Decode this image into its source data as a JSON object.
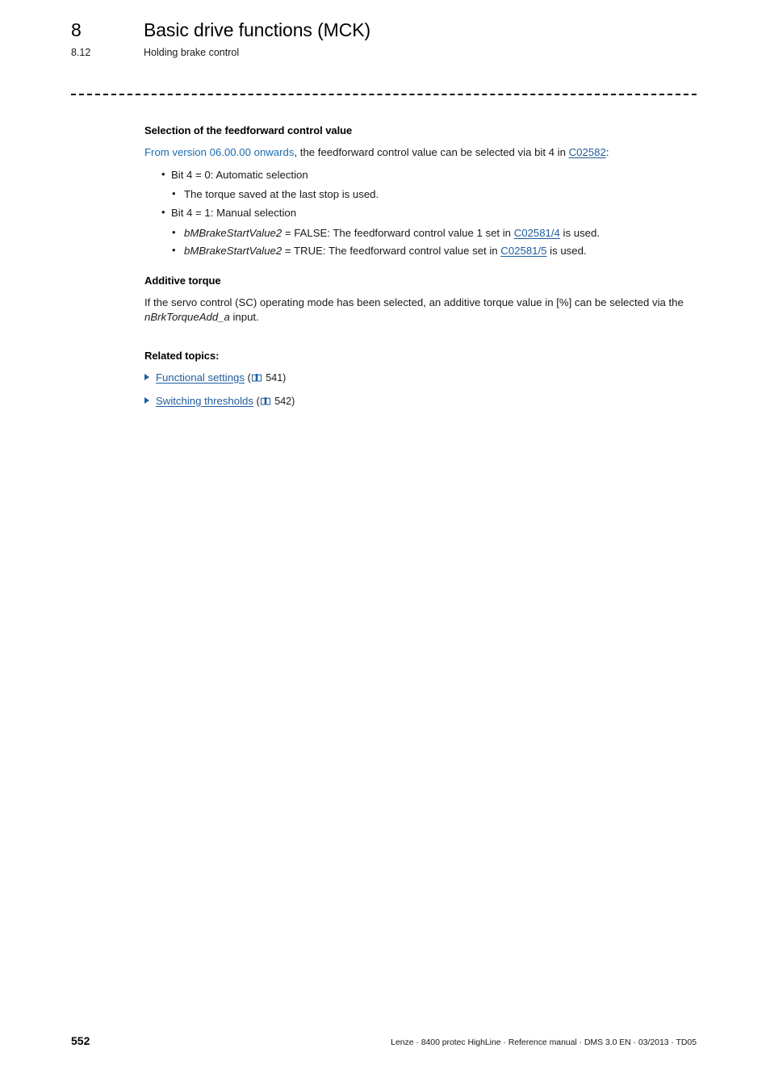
{
  "header": {
    "chapter_number": "8",
    "chapter_title": "Basic drive functions (MCK)",
    "section_number": "8.12",
    "section_title": "Holding brake control"
  },
  "content": {
    "feedforward": {
      "heading": "Selection of the feedforward control value",
      "intro_version": "From version 06.00.00 onwards",
      "intro_rest": ", the feedforward control value can be selected via bit 4 in ",
      "intro_link": "C02582",
      "intro_end": ":",
      "bullets": [
        {
          "text": "Bit 4 = 0: Automatic selection",
          "sub": [
            {
              "text": "The torque saved at the last stop is used."
            }
          ]
        },
        {
          "text": "Bit 4 = 1: Manual selection",
          "sub": [
            {
              "var": "bMBrakeStartValue2",
              "mid": " = FALSE: The feedforward control value 1 set in ",
              "link": "C02581/4",
              "end": " is used."
            },
            {
              "var": "bMBrakeStartValue2",
              "mid": " = TRUE: The feedforward control value set in ",
              "link": "C02581/5",
              "end": " is used."
            }
          ]
        }
      ]
    },
    "additive_torque": {
      "heading": "Additive torque",
      "body_start": "If the servo control (SC) operating mode has been selected, an additive torque value in [%] can be selected via the ",
      "body_var": "nBrkTorqueAdd_a",
      "body_end": " input."
    },
    "related_topics": {
      "heading": "Related topics:",
      "items": [
        {
          "label": "Functional settings",
          "page": "541",
          "icon": "book-icon",
          "bullet_icon": "triangle-right-icon"
        },
        {
          "label": "Switching thresholds",
          "page": "542",
          "icon": "book-icon",
          "bullet_icon": "triangle-right-icon"
        }
      ]
    }
  },
  "footer": {
    "page_number": "552",
    "info": "Lenze · 8400 protec HighLine · Reference manual · DMS 3.0 EN · 03/2013 · TD05"
  },
  "colors": {
    "link_blue": "#1f5c9e",
    "accent_blue": "#1b6cb0",
    "text": "#1a1a1a"
  }
}
